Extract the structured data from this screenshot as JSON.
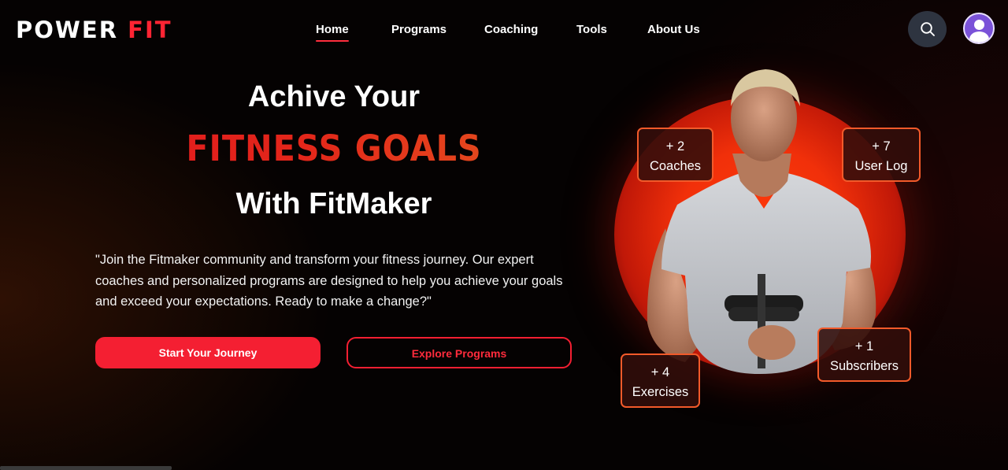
{
  "brand": {
    "name": "POWER",
    "accent": "FIT",
    "accent_color": "#ff2433"
  },
  "nav": {
    "items": [
      {
        "label": "Home",
        "active": true
      },
      {
        "label": "Programs",
        "active": false
      },
      {
        "label": "Coaching",
        "active": false
      },
      {
        "label": "Tools",
        "active": false
      },
      {
        "label": "About Us",
        "active": false
      }
    ],
    "search_icon": "search-icon",
    "avatar_icon": "user-icon"
  },
  "hero": {
    "line1": "Achive Your",
    "line2": "FITNESS GOALS",
    "line3": "With FitMaker",
    "description": "\"Join the Fitmaker community and transform your fitness journey. Our expert coaches and personalized programs are designed to help you achieve your goals and exceed your expectations. Ready to make a change?\"",
    "primary_button": "Start Your Journey",
    "secondary_button": "Explore Programs",
    "button_color": "#f41f32"
  },
  "stats": {
    "coaches": {
      "value": "+ 2",
      "label": "Coaches"
    },
    "user_log": {
      "value": "+ 7",
      "label": "User Log"
    },
    "subscribers": {
      "value": "+ 1",
      "label": "Subscribers"
    },
    "exercises": {
      "value": "+ 4",
      "label": "Exercises"
    }
  }
}
